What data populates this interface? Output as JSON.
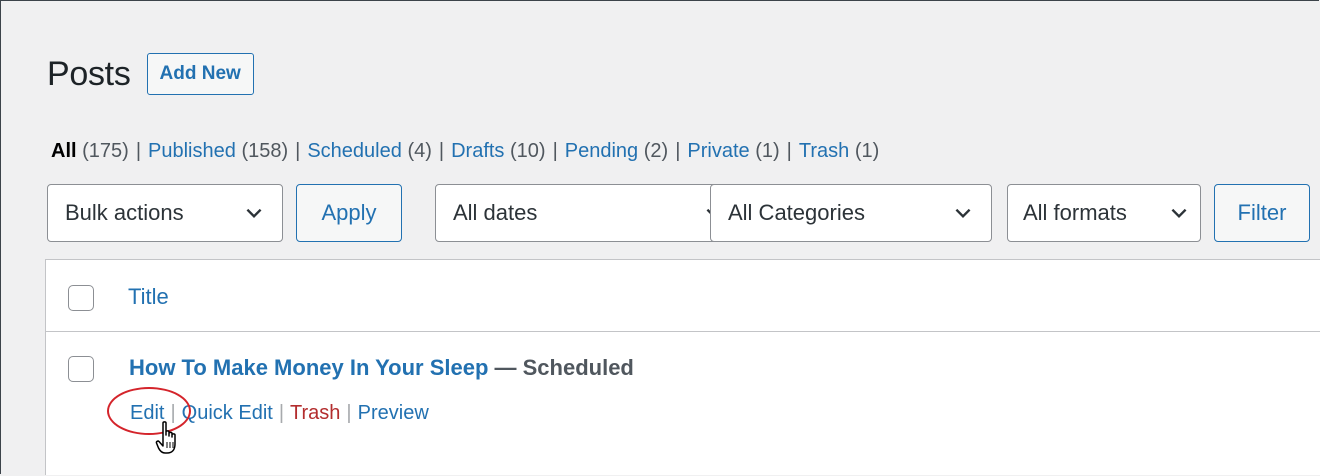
{
  "header": {
    "title": "Posts",
    "add_new_label": "Add New"
  },
  "views": [
    {
      "label": "All",
      "count": "(175)",
      "current": true
    },
    {
      "label": "Published",
      "count": "(158)"
    },
    {
      "label": "Scheduled",
      "count": "(4)"
    },
    {
      "label": "Drafts",
      "count": "(10)"
    },
    {
      "label": "Pending",
      "count": "(2)"
    },
    {
      "label": "Private",
      "count": "(1)"
    },
    {
      "label": "Trash",
      "count": "(1)"
    }
  ],
  "separator": "|",
  "tablenav": {
    "bulk_actions": "Bulk actions",
    "apply_label": "Apply",
    "dates": "All dates",
    "categories": "All Categories",
    "formats": "All formats",
    "filter_label": "Filter"
  },
  "table": {
    "column_title": "Title",
    "rows": [
      {
        "title": "How To Make Money In Your Sleep",
        "state": "— Scheduled",
        "actions": {
          "edit": "Edit",
          "quick_edit": "Quick Edit",
          "trash": "Trash",
          "preview": "Preview"
        }
      }
    ]
  },
  "icons": {
    "chevron": "chevron-down-icon",
    "cursor": "hand-pointer-icon"
  },
  "colors": {
    "link": "#2271b1",
    "trash": "#b32d2e",
    "highlight": "#d4242b"
  }
}
